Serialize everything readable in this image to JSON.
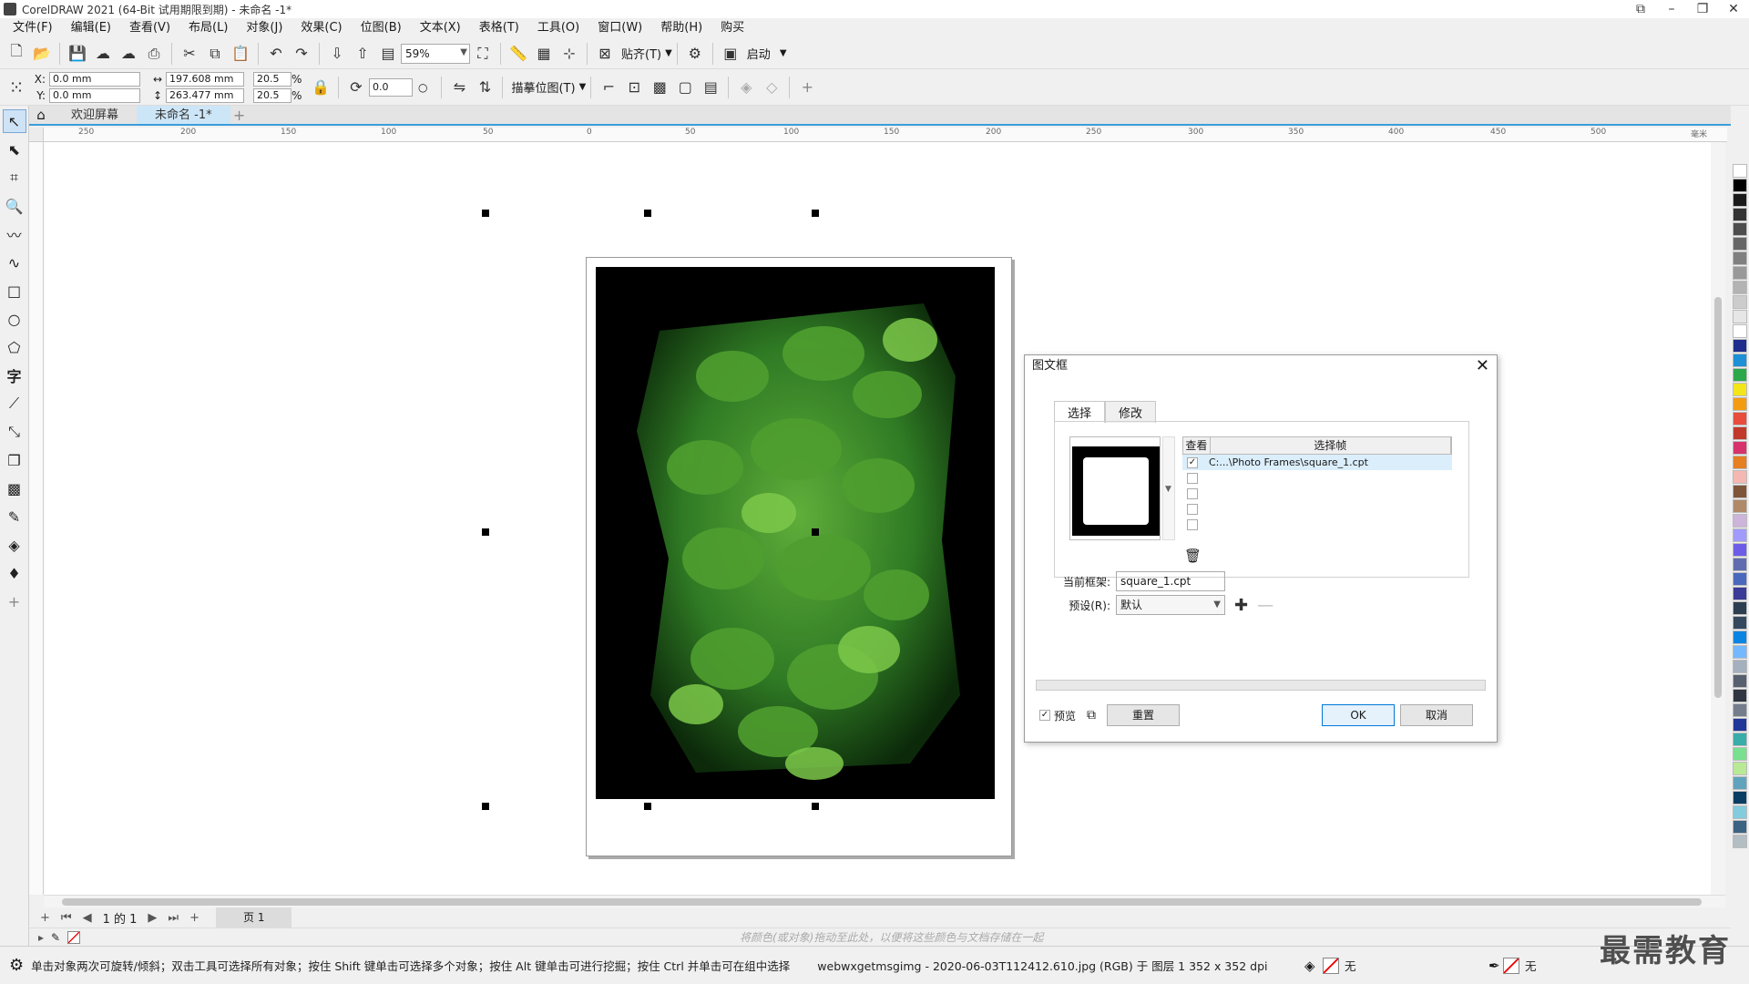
{
  "window": {
    "title": "CorelDRAW 2021 (64-Bit 试用期限到期) - 未命名 -1*"
  },
  "menu": [
    "文件(F)",
    "编辑(E)",
    "查看(V)",
    "布局(L)",
    "对象(J)",
    "效果(C)",
    "位图(B)",
    "文本(X)",
    "表格(T)",
    "工具(O)",
    "窗口(W)",
    "帮助(H)",
    "购买"
  ],
  "toolbar": {
    "zoom": "59%",
    "snap_label": "贴齐(T)",
    "launch_label": "启动"
  },
  "propbar": {
    "x": "0.0 mm",
    "y": "0.0 mm",
    "width": "197.608 mm",
    "height": "263.477 mm",
    "scale_x": "20.5",
    "scale_y": "20.5",
    "percent": "%",
    "rotation": "0.0",
    "trace_label": "描摹位图(T)",
    "x_label": "X:",
    "y_label": "Y:"
  },
  "doctabs": {
    "welcome": "欢迎屏幕",
    "doc": "未命名 -1*"
  },
  "ruler_h": [
    "250",
    "200",
    "150",
    "100",
    "50",
    "0",
    "50",
    "100",
    "150",
    "200",
    "250",
    "300",
    "350",
    "400",
    "450",
    "500"
  ],
  "ruler_unit": "毫米",
  "dialog": {
    "title": "图文框",
    "tab_select": "选择",
    "tab_modify": "修改",
    "col_view": "查看",
    "col_frame": "选择帧",
    "frame_file": "C:...\\Photo Frames\\square_1.cpt",
    "current_label": "当前框架:",
    "current_value": "square_1.cpt",
    "preset_label": "预设(R):",
    "preset_value": "默认",
    "preview_label": "预览",
    "reset_label": "重置",
    "ok_label": "OK",
    "cancel_label": "取消"
  },
  "pagebar": {
    "page_info": "1 的 1",
    "page_tab": "页 1"
  },
  "colorbar": {
    "hint": "将颜色(或对象)拖动至此处，以便将这些颜色与文档存储在一起"
  },
  "status": {
    "hint": "单击对象两次可旋转/倾斜；双击工具可选择所有对象；按住 Shift 键单击可选择多个对象；按住 Alt 键单击可进行挖掘；按住 Ctrl 并单击可在组中选择",
    "file_info": "webwxgetmsgimg - 2020-06-03T112412.610.jpg (RGB) 于 图层 1 352 x 352 dpi",
    "fill_none": "无",
    "outline_none": "无"
  },
  "watermark": "最需教育",
  "palette": [
    "#ffffff",
    "#000000",
    "#1a1a1a",
    "#333333",
    "#4d4d4d",
    "#666666",
    "#808080",
    "#999999",
    "#b3b3b3",
    "#cccccc",
    "#e6e6e6",
    "#ffffff",
    "#1f2d8c",
    "#1e90d6",
    "#2aa84a",
    "#f2e51a",
    "#f39c12",
    "#e74c3c",
    "#c0392b",
    "#d6336c",
    "#e67e22",
    "#f5b7b1",
    "#7f5539",
    "#b08968",
    "#cdb4db",
    "#a29bfe",
    "#6c5ce7",
    "#5f6caf",
    "#4a69bd",
    "#3b3b98",
    "#2c3e50",
    "#34495e",
    "#0984e3",
    "#74b9ff",
    "#a4b0be",
    "#57606f",
    "#2f3542",
    "#747d8c",
    "#1e3799",
    "#38ada9",
    "#78e08f",
    "#b8e994",
    "#60a3bc",
    "#0a3d62",
    "#82ccdd",
    "#3c6382",
    "#b2bec3"
  ],
  "colors": {
    "accent": "#3c9ddc",
    "selection": "#dbeefb"
  }
}
